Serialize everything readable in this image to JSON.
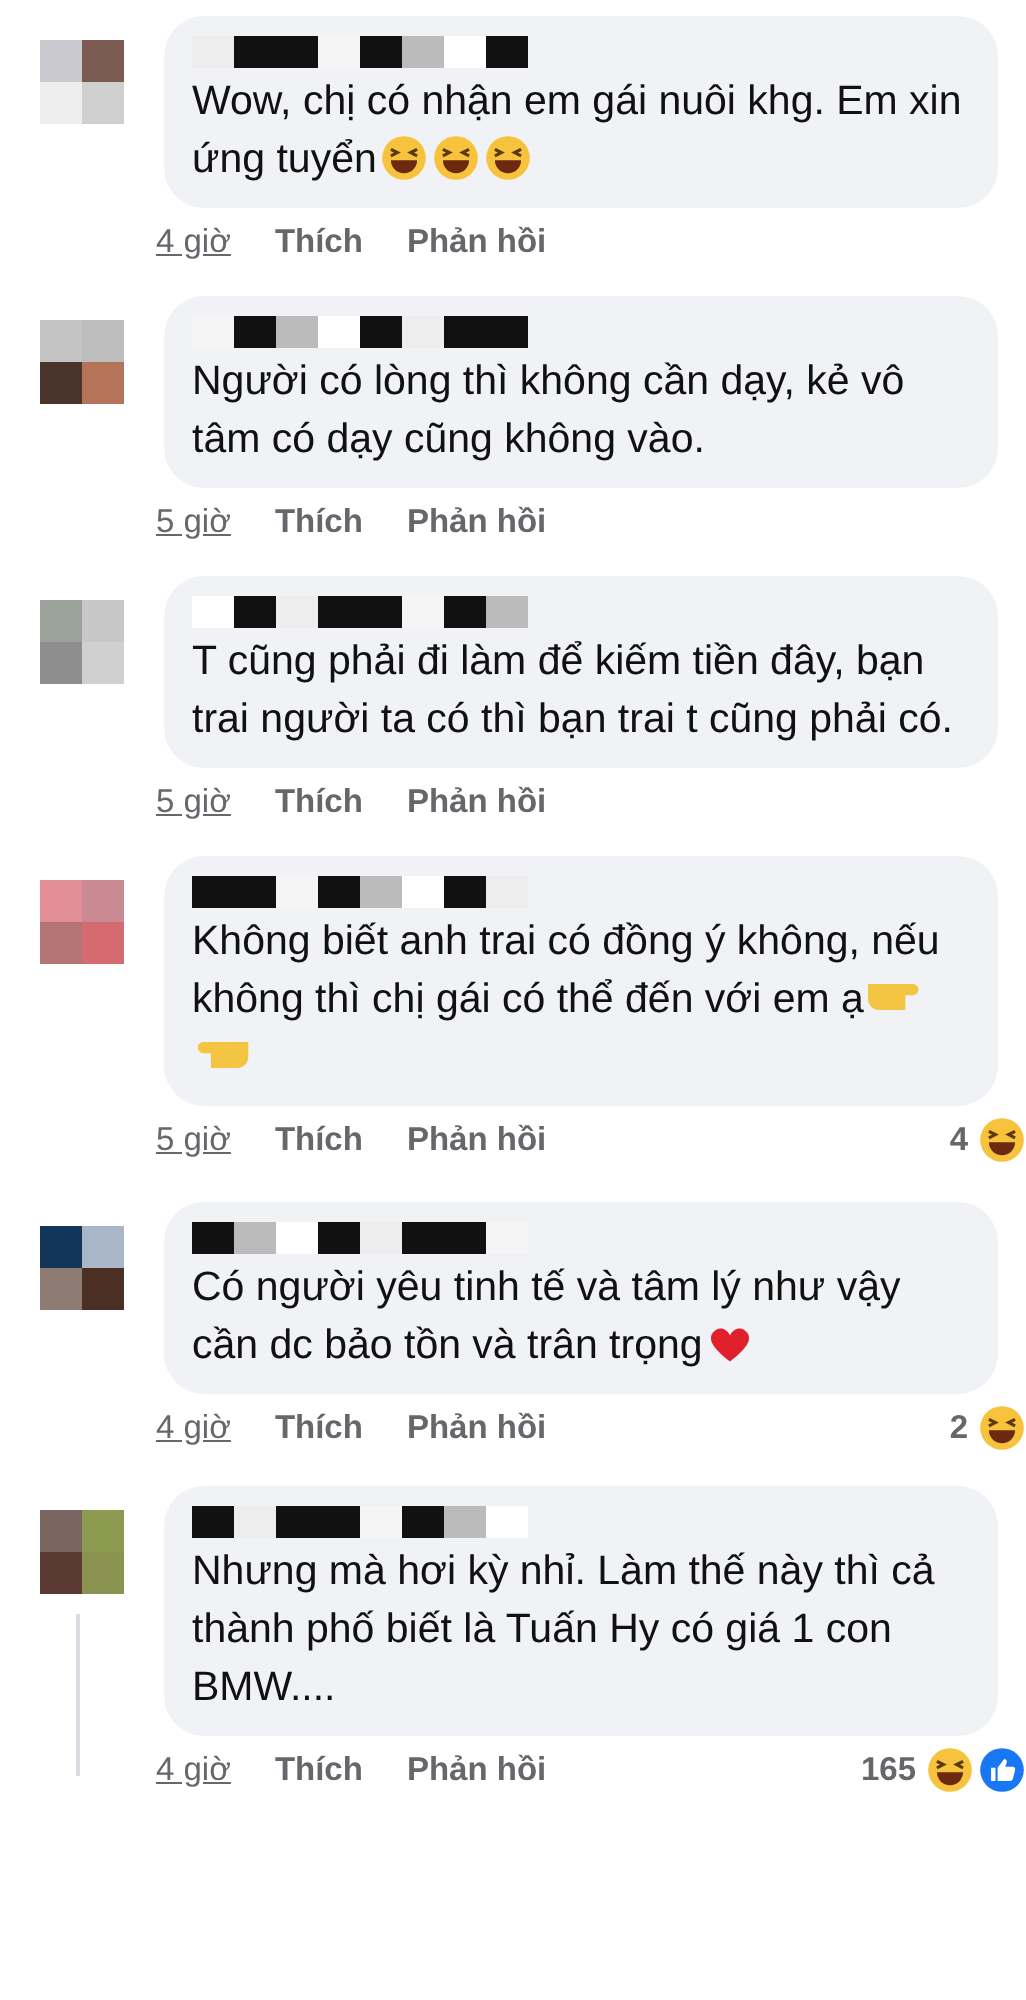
{
  "comments": [
    {
      "text": "Wow, chị có nhận em gái nuôi khg. Em xin ứng tuyển",
      "emojis": [
        {
          "kind": "rofl"
        },
        {
          "kind": "rofl"
        },
        {
          "kind": "rofl"
        }
      ],
      "time": "4 giờ",
      "like": "Thích",
      "reply": "Phản hồi"
    },
    {
      "text": "Người có lòng thì không cần dạy, kẻ vô tâm có dạy cũng không vào.",
      "time": "5 giờ",
      "like": "Thích",
      "reply": "Phản hồi"
    },
    {
      "text": "T cũng phải đi làm để kiếm tiền đây, bạn trai người ta có thì bạn trai t cũng phải có.",
      "time": "5 giờ",
      "like": "Thích",
      "reply": "Phản hồi"
    },
    {
      "text": "Không biết anh trai có đồng ý không, nếu không thì chị gái có thể đến với em ạ",
      "emojis": [
        {
          "kind": "point-right"
        },
        {
          "kind": "point-left"
        }
      ],
      "time": "5 giờ",
      "like": "Thích",
      "reply": "Phản hồi",
      "reaction_count": "4",
      "reactions": [
        {
          "kind": "haha"
        }
      ]
    },
    {
      "text": "Có người yêu tinh tế và tâm lý như vậy cần dc bảo tồn và trân trọng",
      "emojis": [
        {
          "kind": "heart"
        }
      ],
      "time": "4 giờ",
      "like": "Thích",
      "reply": "Phản hồi",
      "reaction_count": "2",
      "reactions": [
        {
          "kind": "haha"
        }
      ]
    },
    {
      "text": "Nhưng mà hơi kỳ nhỉ. Làm thế này thì cả thành phố biết là Tuấn Hy có giá 1 con BMW....",
      "time": "4 giờ",
      "like": "Thích",
      "reply": "Phản hồi",
      "reaction_count": "165",
      "reactions": [
        {
          "kind": "haha"
        },
        {
          "kind": "like"
        }
      ],
      "thread_line": true
    }
  ]
}
